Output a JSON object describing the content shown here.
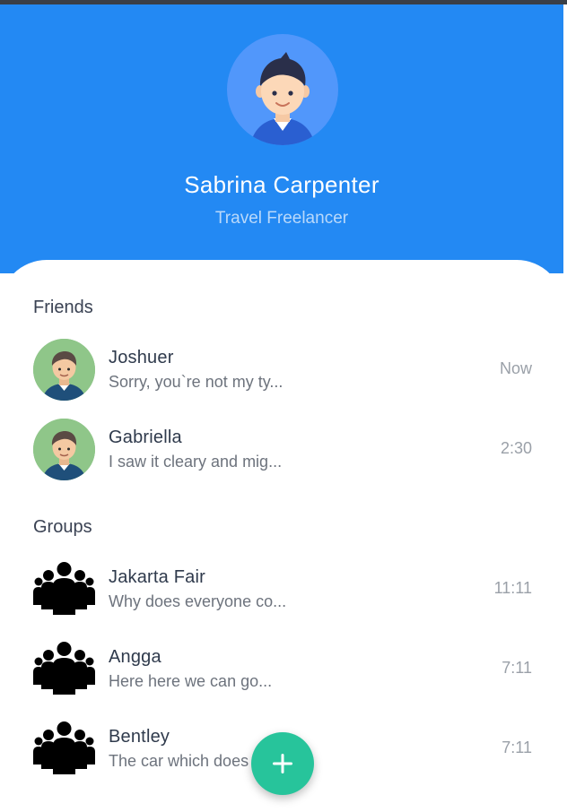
{
  "profile": {
    "name": "Sabrina Carpenter",
    "role": "Travel Freelancer"
  },
  "sections": {
    "friends_title": "Friends",
    "groups_title": "Groups"
  },
  "friends": [
    {
      "name": "Joshuer",
      "message": "Sorry, you`re not my ty...",
      "time": "Now"
    },
    {
      "name": "Gabriella",
      "message": "I saw it cleary and mig...",
      "time": "2:30"
    }
  ],
  "groups": [
    {
      "name": "Jakarta Fair",
      "message": "Why does everyone co...",
      "time": "11:11"
    },
    {
      "name": "Angga",
      "message": "Here here we can go...",
      "time": "7:11"
    },
    {
      "name": "Bentley",
      "message": "The car which does not...",
      "time": "7:11"
    }
  ],
  "fab": {
    "icon": "plus-icon"
  },
  "colors": {
    "header": "#2389f3",
    "fab": "#27c49b",
    "avatar_bg": "#5197fb"
  }
}
